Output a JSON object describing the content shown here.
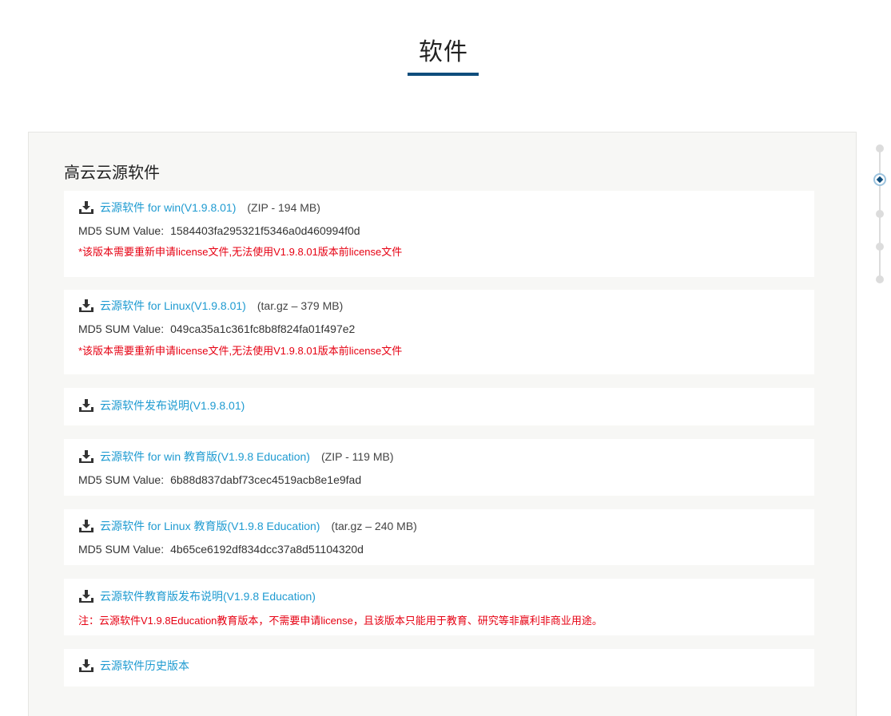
{
  "page": {
    "title": "软件"
  },
  "section": {
    "heading": "高云云源软件"
  },
  "md5_label": "MD5 SUM Value:",
  "items": [
    {
      "link": "云源软件 for win(V1.9.8.01)",
      "size": "(ZIP - 194 MB)",
      "md5": "1584403fa295321f5346a0d460994f0d",
      "note": "*该版本需要重新申请license文件,无法使用V1.9.8.01版本前license文件"
    },
    {
      "link": "云源软件 for Linux(V1.9.8.01)",
      "size": "(tar.gz – 379 MB)",
      "md5": "049ca35a1c361fc8b8f824fa01f497e2",
      "note": "*该版本需要重新申请license文件,无法使用V1.9.8.01版本前license文件"
    },
    {
      "link": "云源软件发布说明(V1.9.8.01)"
    },
    {
      "link": "云源软件 for win 教育版(V1.9.8 Education)",
      "size": "(ZIP - 119 MB)",
      "md5": "6b88d837dabf73cec4519acb8e1e9fad"
    },
    {
      "link": "云源软件 for Linux 教育版(V1.9.8 Education)",
      "size": "(tar.gz – 240 MB)",
      "md5": "4b65ce6192df834dcc37a8d51104320d"
    },
    {
      "link": "云源软件教育版发布说明(V1.9.8 Education)",
      "note": "注：云源软件V1.9.8Education教育版本，不需要申请license，且该版本只能用于教育、研究等非赢利非商业用途。"
    },
    {
      "link": "云源软件历史版本"
    }
  ],
  "icons": {
    "download": "download-icon"
  },
  "side_nav": {
    "active_index": 1,
    "count": 5
  },
  "colors": {
    "link": "#1f9bd1",
    "note": "#e60012",
    "accent": "#0f4d7c",
    "panel_bg": "#f7f7f5"
  }
}
